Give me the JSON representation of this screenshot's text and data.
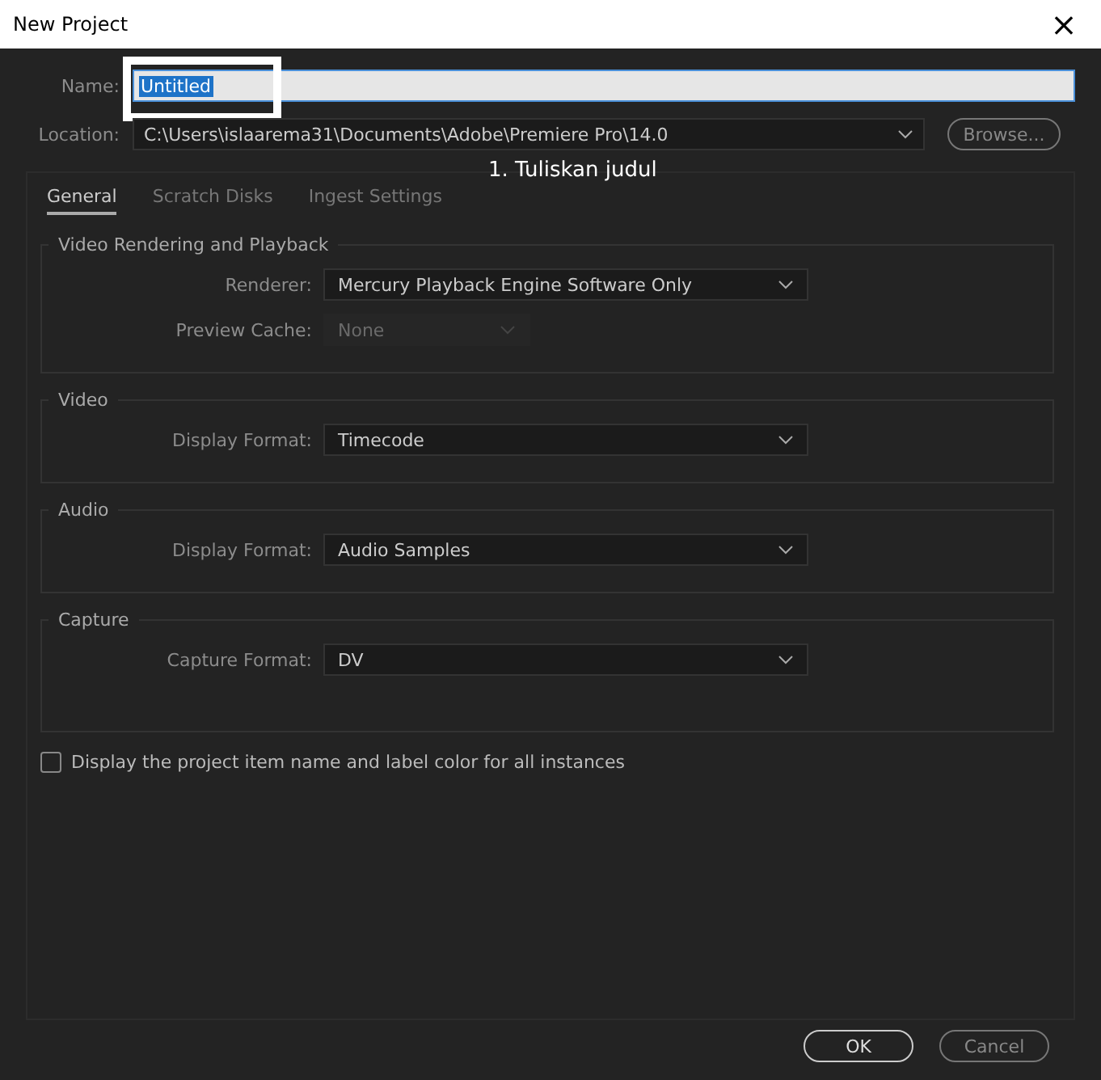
{
  "window": {
    "title": "New Project",
    "close": "×"
  },
  "name_field": {
    "label": "Name:",
    "value": "Untitled"
  },
  "location": {
    "label": "Location:",
    "value": "C:\\Users\\islaarema31\\Documents\\Adobe\\Premiere Pro\\14.0",
    "button": "Browse..."
  },
  "annotation": {
    "text": "1. Tuliskan judul"
  },
  "tabs": [
    {
      "label": "General",
      "selected": true
    },
    {
      "label": "Scratch Disks",
      "selected": false
    },
    {
      "label": "Ingest Settings",
      "selected": false
    }
  ],
  "groups": [
    {
      "title": "Video Rendering and Playback",
      "rows": [
        {
          "label": "Renderer:",
          "value": "Mercury Playback Engine Software Only",
          "disabled": false
        },
        {
          "label": "Preview Cache:",
          "value": "None",
          "disabled": true
        }
      ]
    },
    {
      "title": "Video",
      "rows": [
        {
          "label": "Display Format:",
          "value": "Timecode",
          "disabled": false
        }
      ]
    },
    {
      "title": "Audio",
      "rows": [
        {
          "label": "Display Format:",
          "value": "Audio Samples",
          "disabled": false
        }
      ]
    },
    {
      "title": "Capture",
      "rows": [
        {
          "label": "Capture Format:",
          "value": "DV",
          "disabled": false
        }
      ]
    }
  ],
  "checkbox": {
    "label": "Display the project item name and label color for all instances",
    "checked": false
  },
  "buttons": [
    {
      "label": "OK",
      "kind": "primary"
    },
    {
      "label": "Cancel",
      "kind": "secondary"
    }
  ]
}
